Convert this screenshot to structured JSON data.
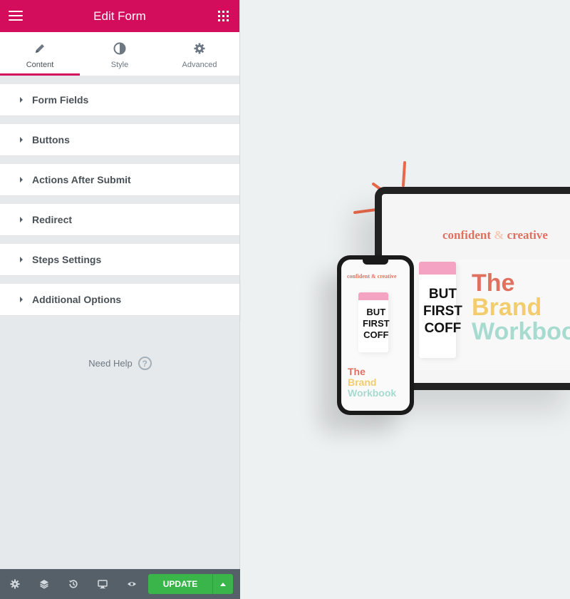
{
  "header": {
    "title": "Edit Form"
  },
  "tabs": [
    {
      "label": "Content",
      "icon": "pencil-icon",
      "active": true
    },
    {
      "label": "Style",
      "icon": "contrast-icon",
      "active": false
    },
    {
      "label": "Advanced",
      "icon": "gear-icon",
      "active": false
    }
  ],
  "sections": [
    {
      "label": "Form Fields"
    },
    {
      "label": "Buttons"
    },
    {
      "label": "Actions After Submit"
    },
    {
      "label": "Redirect"
    },
    {
      "label": "Steps Settings"
    },
    {
      "label": "Additional Options"
    }
  ],
  "help": {
    "label": "Need Help",
    "glyph": "?"
  },
  "footer": {
    "icons": [
      "settings-icon",
      "layers-icon",
      "history-icon",
      "responsive-icon",
      "preview-eye-icon"
    ],
    "update_label": "UPDATE"
  },
  "preview": {
    "laptop_brand_a": "confident",
    "laptop_brand_amp": "&",
    "laptop_brand_b": "creative",
    "title_line1": "The",
    "title_line2": "Brand",
    "title_line3": "Workbook",
    "cup_text": "BUT\nFIRST\nCOFF",
    "phone_brand": "confident & creative"
  },
  "colors": {
    "accent": "#d30c5c",
    "update": "#39b54a",
    "footer": "#556068",
    "brand_coral": "#e07060",
    "brand_yellow": "#f3cd6d",
    "brand_mint": "#a7dbd0"
  }
}
